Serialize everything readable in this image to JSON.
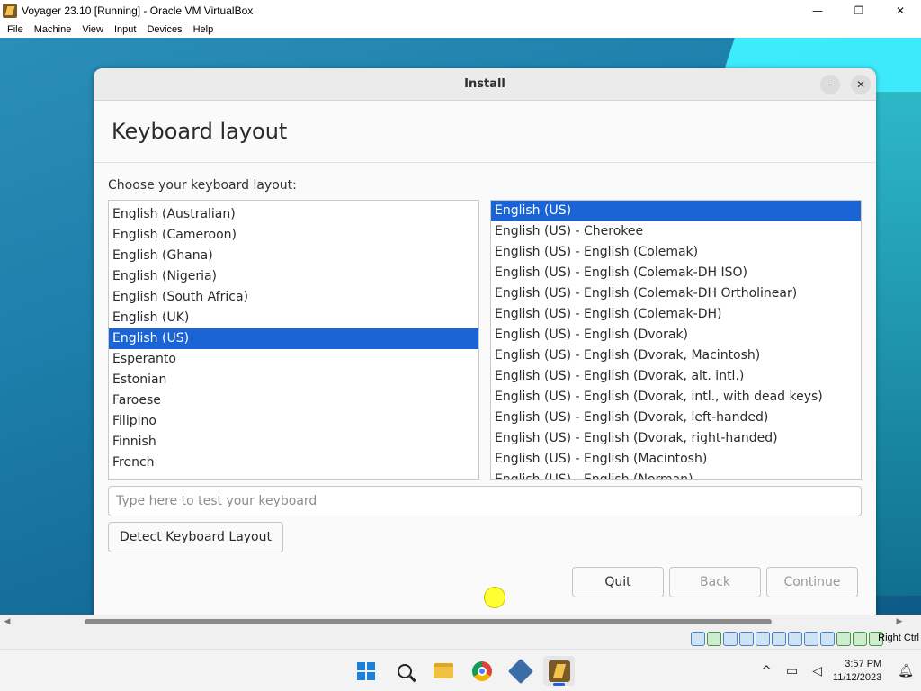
{
  "host": {
    "title": "Voyager 23.10 [Running] - Oracle VM VirtualBox",
    "window_controls": {
      "minimize": "—",
      "maximize": "❐",
      "close": "✕"
    },
    "menu": [
      "File",
      "Machine",
      "View",
      "Input",
      "Devices",
      "Help"
    ],
    "right_ctrl": "Right Ctrl"
  },
  "dialog": {
    "title": "Install",
    "minimize_glyph": "–",
    "close_glyph": "✕",
    "page_title": "Keyboard layout",
    "choose_label": "Choose your keyboard layout:",
    "layouts": [
      "English (Australian)",
      "English (Cameroon)",
      "English (Ghana)",
      "English (Nigeria)",
      "English (South Africa)",
      "English (UK)",
      "English (US)",
      "Esperanto",
      "Estonian",
      "Faroese",
      "Filipino",
      "Finnish",
      "French"
    ],
    "selected_layout": "English (US)",
    "variants": [
      "English (US)",
      "English (US) - Cherokee",
      "English (US) - English (Colemak)",
      "English (US) - English (Colemak-DH ISO)",
      "English (US) - English (Colemak-DH Ortholinear)",
      "English (US) - English (Colemak-DH)",
      "English (US) - English (Dvorak)",
      "English (US) - English (Dvorak, Macintosh)",
      "English (US) - English (Dvorak, alt. intl.)",
      "English (US) - English (Dvorak, intl., with dead keys)",
      "English (US) - English (Dvorak, left-handed)",
      "English (US) - English (Dvorak, right-handed)",
      "English (US) - English (Macintosh)",
      "English (US) - English (Norman)"
    ],
    "selected_variant": "English (US)",
    "test_placeholder": "Type here to test your keyboard",
    "test_value": "",
    "detect_button": "Detect Keyboard Layout",
    "quit_button": "Quit",
    "back_button": "Back",
    "continue_button": "Continue"
  },
  "taskbar": {
    "apps": [
      "start-icon",
      "search-icon",
      "file-explorer-icon",
      "chrome-icon",
      "virtualbox-icon",
      "voyager-vm-icon"
    ],
    "time": "3:57 PM",
    "date": "11/12/2023",
    "tray_chevron": "^"
  },
  "colors": {
    "selection": "#1a64d6",
    "dialog_bg": "#fafafa",
    "desktop_accent": "#3ff0ff"
  }
}
